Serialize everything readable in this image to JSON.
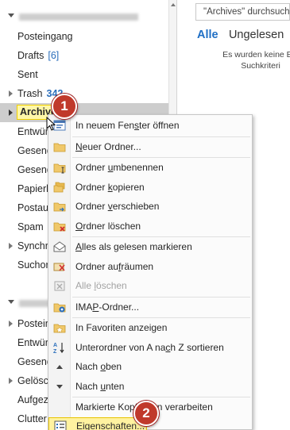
{
  "search": {
    "placeholder": "\"Archives\" durchsuchen"
  },
  "filter_tabs": [
    {
      "label": "Alle",
      "active": true
    },
    {
      "label": "Ungelesen",
      "active": false
    }
  ],
  "list_empty_message": {
    "line1": "Es wurden keine Ele",
    "line2": "Suchkriteri"
  },
  "folders_account1": [
    {
      "label": "Posteingang"
    },
    {
      "label": "Drafts",
      "count": "[6]"
    },
    {
      "label": "Sent"
    },
    {
      "label": "Trash",
      "count": "342",
      "expandable": true
    },
    {
      "label": "Archive",
      "expandable": true,
      "selected": true
    },
    {
      "label": "Entwürf"
    },
    {
      "label": "Gesend"
    },
    {
      "label": "Gesend"
    },
    {
      "label": "Papierk"
    },
    {
      "label": "Postaus"
    },
    {
      "label": "Spam",
      "count": "["
    },
    {
      "label": "Synchro",
      "expandable": true
    },
    {
      "label": "Suchord"
    }
  ],
  "folders_account2": [
    {
      "label": "Postein",
      "expandable": true
    },
    {
      "label": "Entwürf"
    },
    {
      "label": "Gesend"
    },
    {
      "label": "Gelösch",
      "expandable": true
    },
    {
      "label": "Aufgeze"
    },
    {
      "label": "Clutter"
    }
  ],
  "context_menu": [
    {
      "pre": "In neuem Fen",
      "u": "s",
      "post": "ter öffnen",
      "icon": "new-window-icon"
    },
    {
      "sep": true
    },
    {
      "pre": "",
      "u": "N",
      "post": "euer Ordner...",
      "icon": "new-folder-icon"
    },
    {
      "sep": true
    },
    {
      "pre": "Ordner ",
      "u": "u",
      "post": "mbenennen",
      "icon": "rename-folder-icon"
    },
    {
      "pre": "Ordner ",
      "u": "k",
      "post": "opieren",
      "icon": "copy-folder-icon"
    },
    {
      "pre": "Ordner ",
      "u": "v",
      "post": "erschieben",
      "icon": "move-folder-icon"
    },
    {
      "pre": "",
      "u": "O",
      "post": "rdner löschen",
      "icon": "delete-folder-icon"
    },
    {
      "sep": true
    },
    {
      "pre": "",
      "u": "A",
      "post": "lles als gelesen markieren",
      "icon": "mark-read-icon"
    },
    {
      "pre": "Ordner au",
      "u": "f",
      "post": "räumen",
      "icon": "clean-up-icon"
    },
    {
      "pre": "Alle ",
      "u": "l",
      "post": "öschen",
      "icon": "delete-all-icon",
      "disabled": true
    },
    {
      "sep": true
    },
    {
      "pre": "IMA",
      "u": "P",
      "post": "-Ordner...",
      "icon": "imap-folder-icon"
    },
    {
      "sep": true
    },
    {
      "pre": "In Favoriten anzeigen",
      "u": "",
      "post": "",
      "icon": "favorites-icon"
    },
    {
      "pre": "Unterordner von A na",
      "u": "c",
      "post": "h Z sortieren",
      "icon": "sort-az-icon"
    },
    {
      "pre": "Nach ",
      "u": "o",
      "post": "ben",
      "icon": "move-up-icon"
    },
    {
      "pre": "Nach ",
      "u": "u",
      "post": "nten",
      "icon": "move-down-icon"
    },
    {
      "sep": true
    },
    {
      "pre": "Markierte Kopfzeilen verarbeiten",
      "u": "",
      "post": "",
      "icon": "none",
      "disabled": false
    },
    {
      "pre": "",
      "u": "E",
      "post": "igenschaften...",
      "icon": "properties-icon",
      "highlight": true
    }
  ],
  "badges": [
    "1",
    "2"
  ],
  "colors": {
    "accent": "#1f6fc5",
    "count": "#2a6ebb",
    "badge": "#c0392b",
    "highlight": "#fff2a0",
    "highlight_border": "#e8c400"
  }
}
